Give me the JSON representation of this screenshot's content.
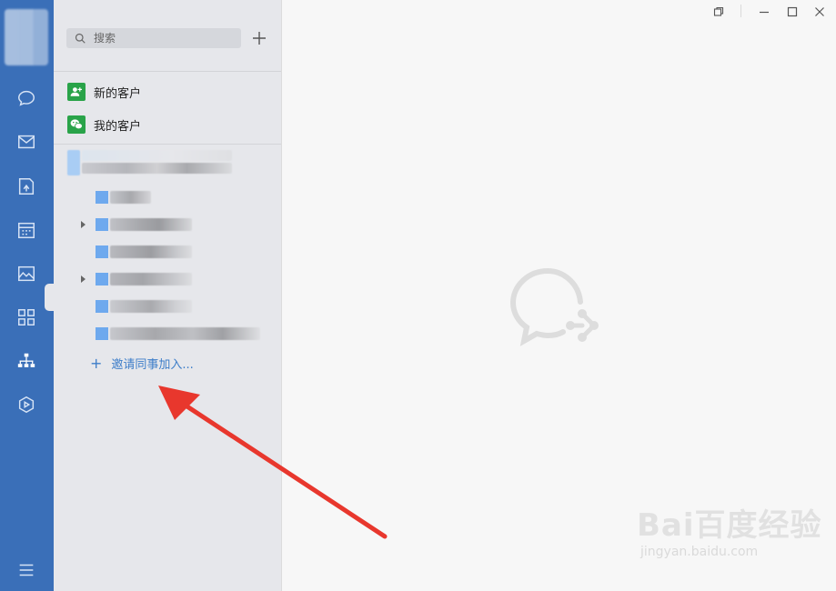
{
  "sidebar": {
    "items": [
      "chat",
      "mail",
      "docs",
      "calendar",
      "photos",
      "workbench",
      "contacts",
      "apps",
      "menu"
    ],
    "active": "contacts"
  },
  "search": {
    "placeholder": "搜索"
  },
  "contacts_panel": {
    "new_customers_label": "新的客户",
    "my_customers_label": "我的客户",
    "invite_label": "邀请同事加入..."
  },
  "colors": {
    "sidebar_bg": "#3a6fb8",
    "panel_bg": "#e6e7eb",
    "accent_green": "#29a349",
    "link_blue": "#3e7ec9",
    "arrow_red": "#e8372d"
  },
  "watermark": {
    "brand": "Bai百度经验",
    "url": "jingyan.baidu.com"
  }
}
